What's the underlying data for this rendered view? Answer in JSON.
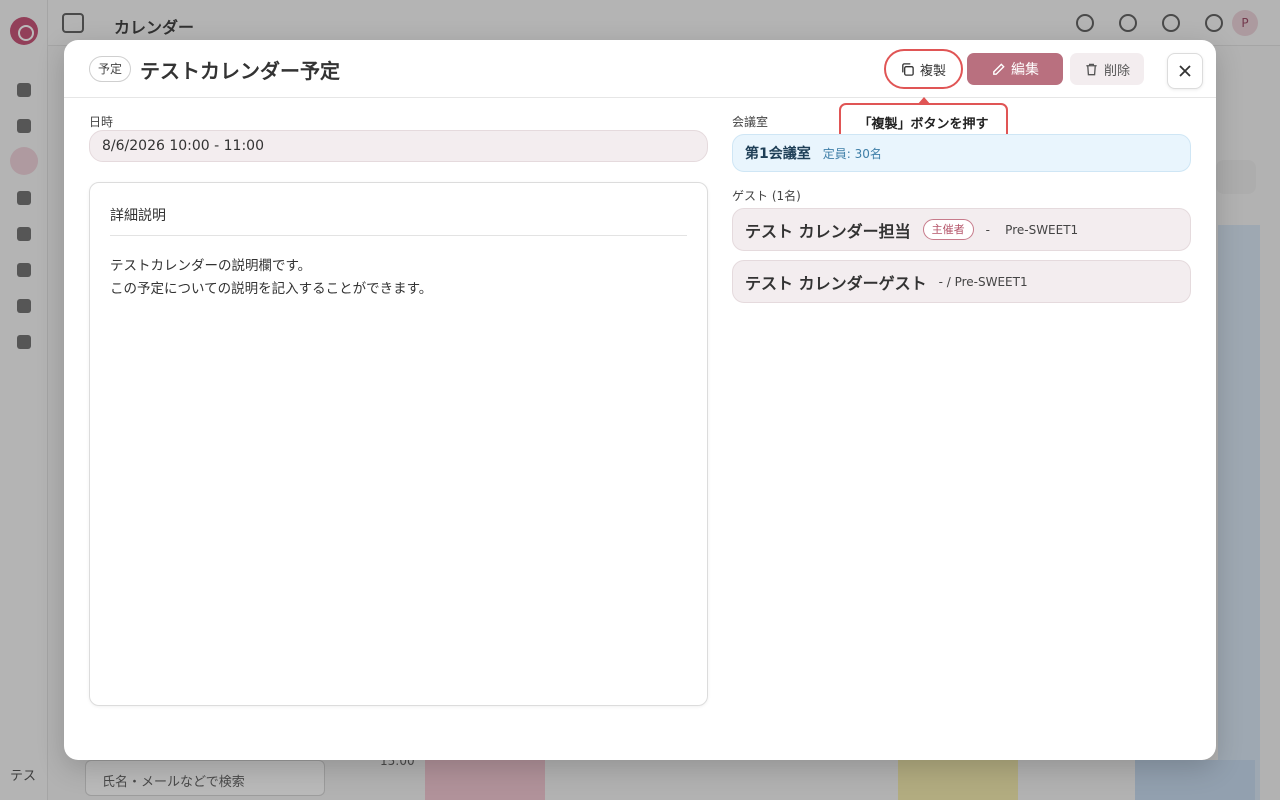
{
  "background_app": {
    "page_title": "カレンダー",
    "search_placeholder": "氏名・メールなどで検索",
    "user_initials": "テス",
    "avatar_initial": "P",
    "time_label": "15:00"
  },
  "modal": {
    "type_badge": "予定",
    "title": "テストカレンダー予定",
    "actions": {
      "duplicate": "複製",
      "edit": "編集",
      "delete": "削除"
    },
    "callout": "「複製」ボタンを押す",
    "datetime_label": "日時",
    "datetime_value": "8/6/2026 10:00 - 11:00",
    "description": {
      "title": "詳細説明",
      "lines": [
        "テストカレンダーの説明欄です。",
        "この予定についての説明を記入することができます。"
      ]
    },
    "room_label": "会議室",
    "room": {
      "name": "第1会議室",
      "capacity": "定員: 30名"
    },
    "guests_label": "ゲスト (1名)",
    "guests": [
      {
        "name": "テスト カレンダー担当",
        "role": "主催者",
        "org": "-    Pre-SWEET1"
      },
      {
        "name": "テスト カレンダーゲスト",
        "org": "- / Pre-SWEET1"
      }
    ]
  },
  "colors": {
    "accent": "#b9707f",
    "highlight": "#e05555",
    "room_bg": "#e9f5fd",
    "chip_bg": "#f3edef"
  }
}
